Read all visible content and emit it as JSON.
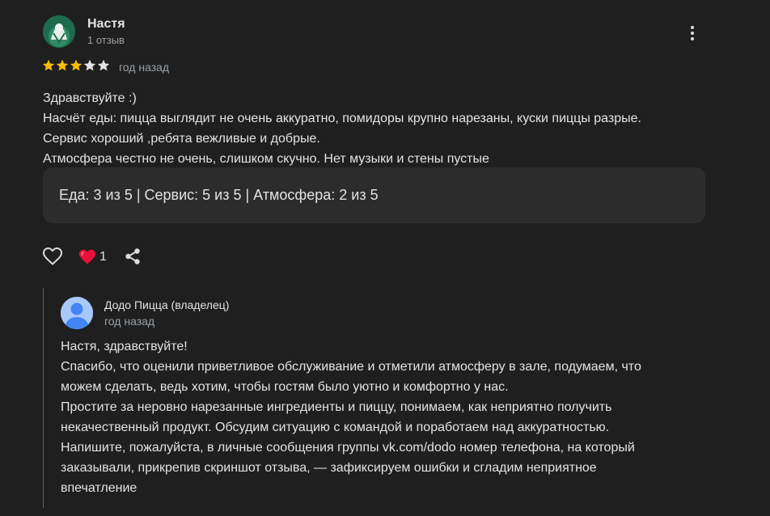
{
  "review": {
    "author_name": "Настя",
    "author_reviews": "1 отзыв",
    "rating": 3,
    "rating_max": 5,
    "time": "год назад",
    "text_lines": [
      "Здравствуйте :)",
      "Насчёт еды: пицца выглядит не очень аккуратно, помидоры крупно нарезаны, куски пиццы разрые.",
      "Сервис хороший ,ребята вежливые и добрые.",
      "Атмосфера честно не очень, слишком скучно. Нет музыки и стены пустые"
    ],
    "attributes": "Еда: 3 из 5  |  Сервис: 5 из 5  |  Атмосфера: 2 из 5",
    "reaction_count": "1"
  },
  "icons": {
    "avatar": "user-avatar-icon",
    "more": "more-vertical-icon",
    "like": "heart-outline-icon",
    "reaction": "heart-filled-icon",
    "share": "share-icon",
    "owner_avatar": "default-user-avatar-icon"
  },
  "owner_reply": {
    "name": "Додо Пицца (владелец)",
    "time": "год назад",
    "text_lines": [
      "Настя, здравствуйте!",
      "Спасибо, что оценили приветливое обслуживание и отметили атмосферу в зале, подумаем, что",
      "можем сделать, ведь хотим, чтобы гостям было уютно и комфортно у нас.",
      "Простите за неровно нарезанные ингредиенты и пиццу, понимаем, как неприятно получить",
      "некачественный продукт. Обсудим ситуацию с командой и поработаем над аккуратностью.",
      "Напишите, пожалуйста, в личные сообщения группы vk.com/dodo номер телефона, на который",
      "заказывали, прикрепив скриншот отзыва, — зафиксируем ошибки и сгладим неприятное",
      "впечатление"
    ]
  },
  "colors": {
    "background": "#1f1f1f",
    "star_filled": "#fbbc04",
    "star_empty": "#e3e3e3",
    "reaction_heart": "#e8113a",
    "secondary_text": "#9aa0a6"
  }
}
